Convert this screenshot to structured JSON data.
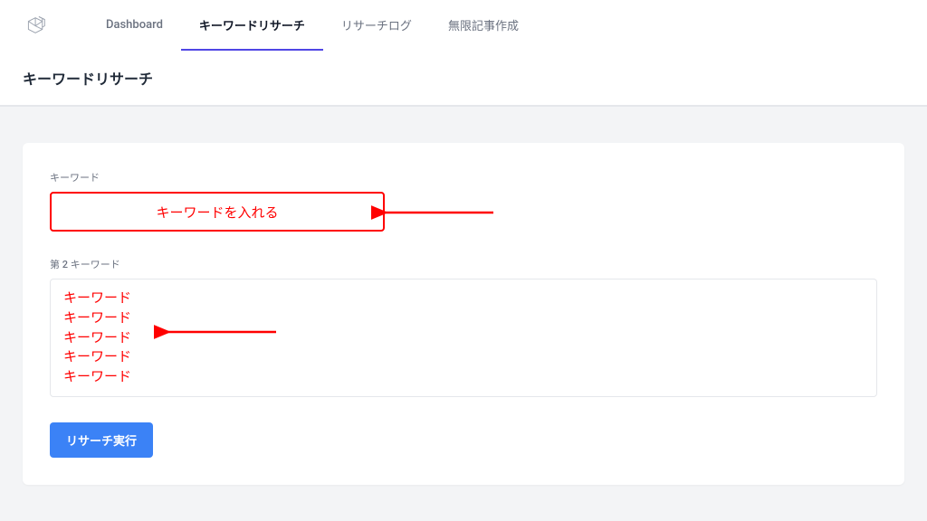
{
  "nav": {
    "items": [
      {
        "label": "Dashboard",
        "active": false
      },
      {
        "label": "キーワードリサーチ",
        "active": true
      },
      {
        "label": "リサーチログ",
        "active": false
      },
      {
        "label": "無限記事作成",
        "active": false
      }
    ]
  },
  "page": {
    "title": "キーワードリサーチ"
  },
  "form": {
    "keyword_label": "キーワード",
    "keyword_annotation": "キーワードを入れる",
    "second_keyword_label": "第 2 キーワード",
    "second_keywords": [
      "キーワード",
      "キーワード",
      "キーワード",
      "キーワード",
      "キーワード"
    ],
    "submit_label": "リサーチ実行"
  },
  "annotation_color": "#ff0000",
  "accent_color": "#3b82f6"
}
